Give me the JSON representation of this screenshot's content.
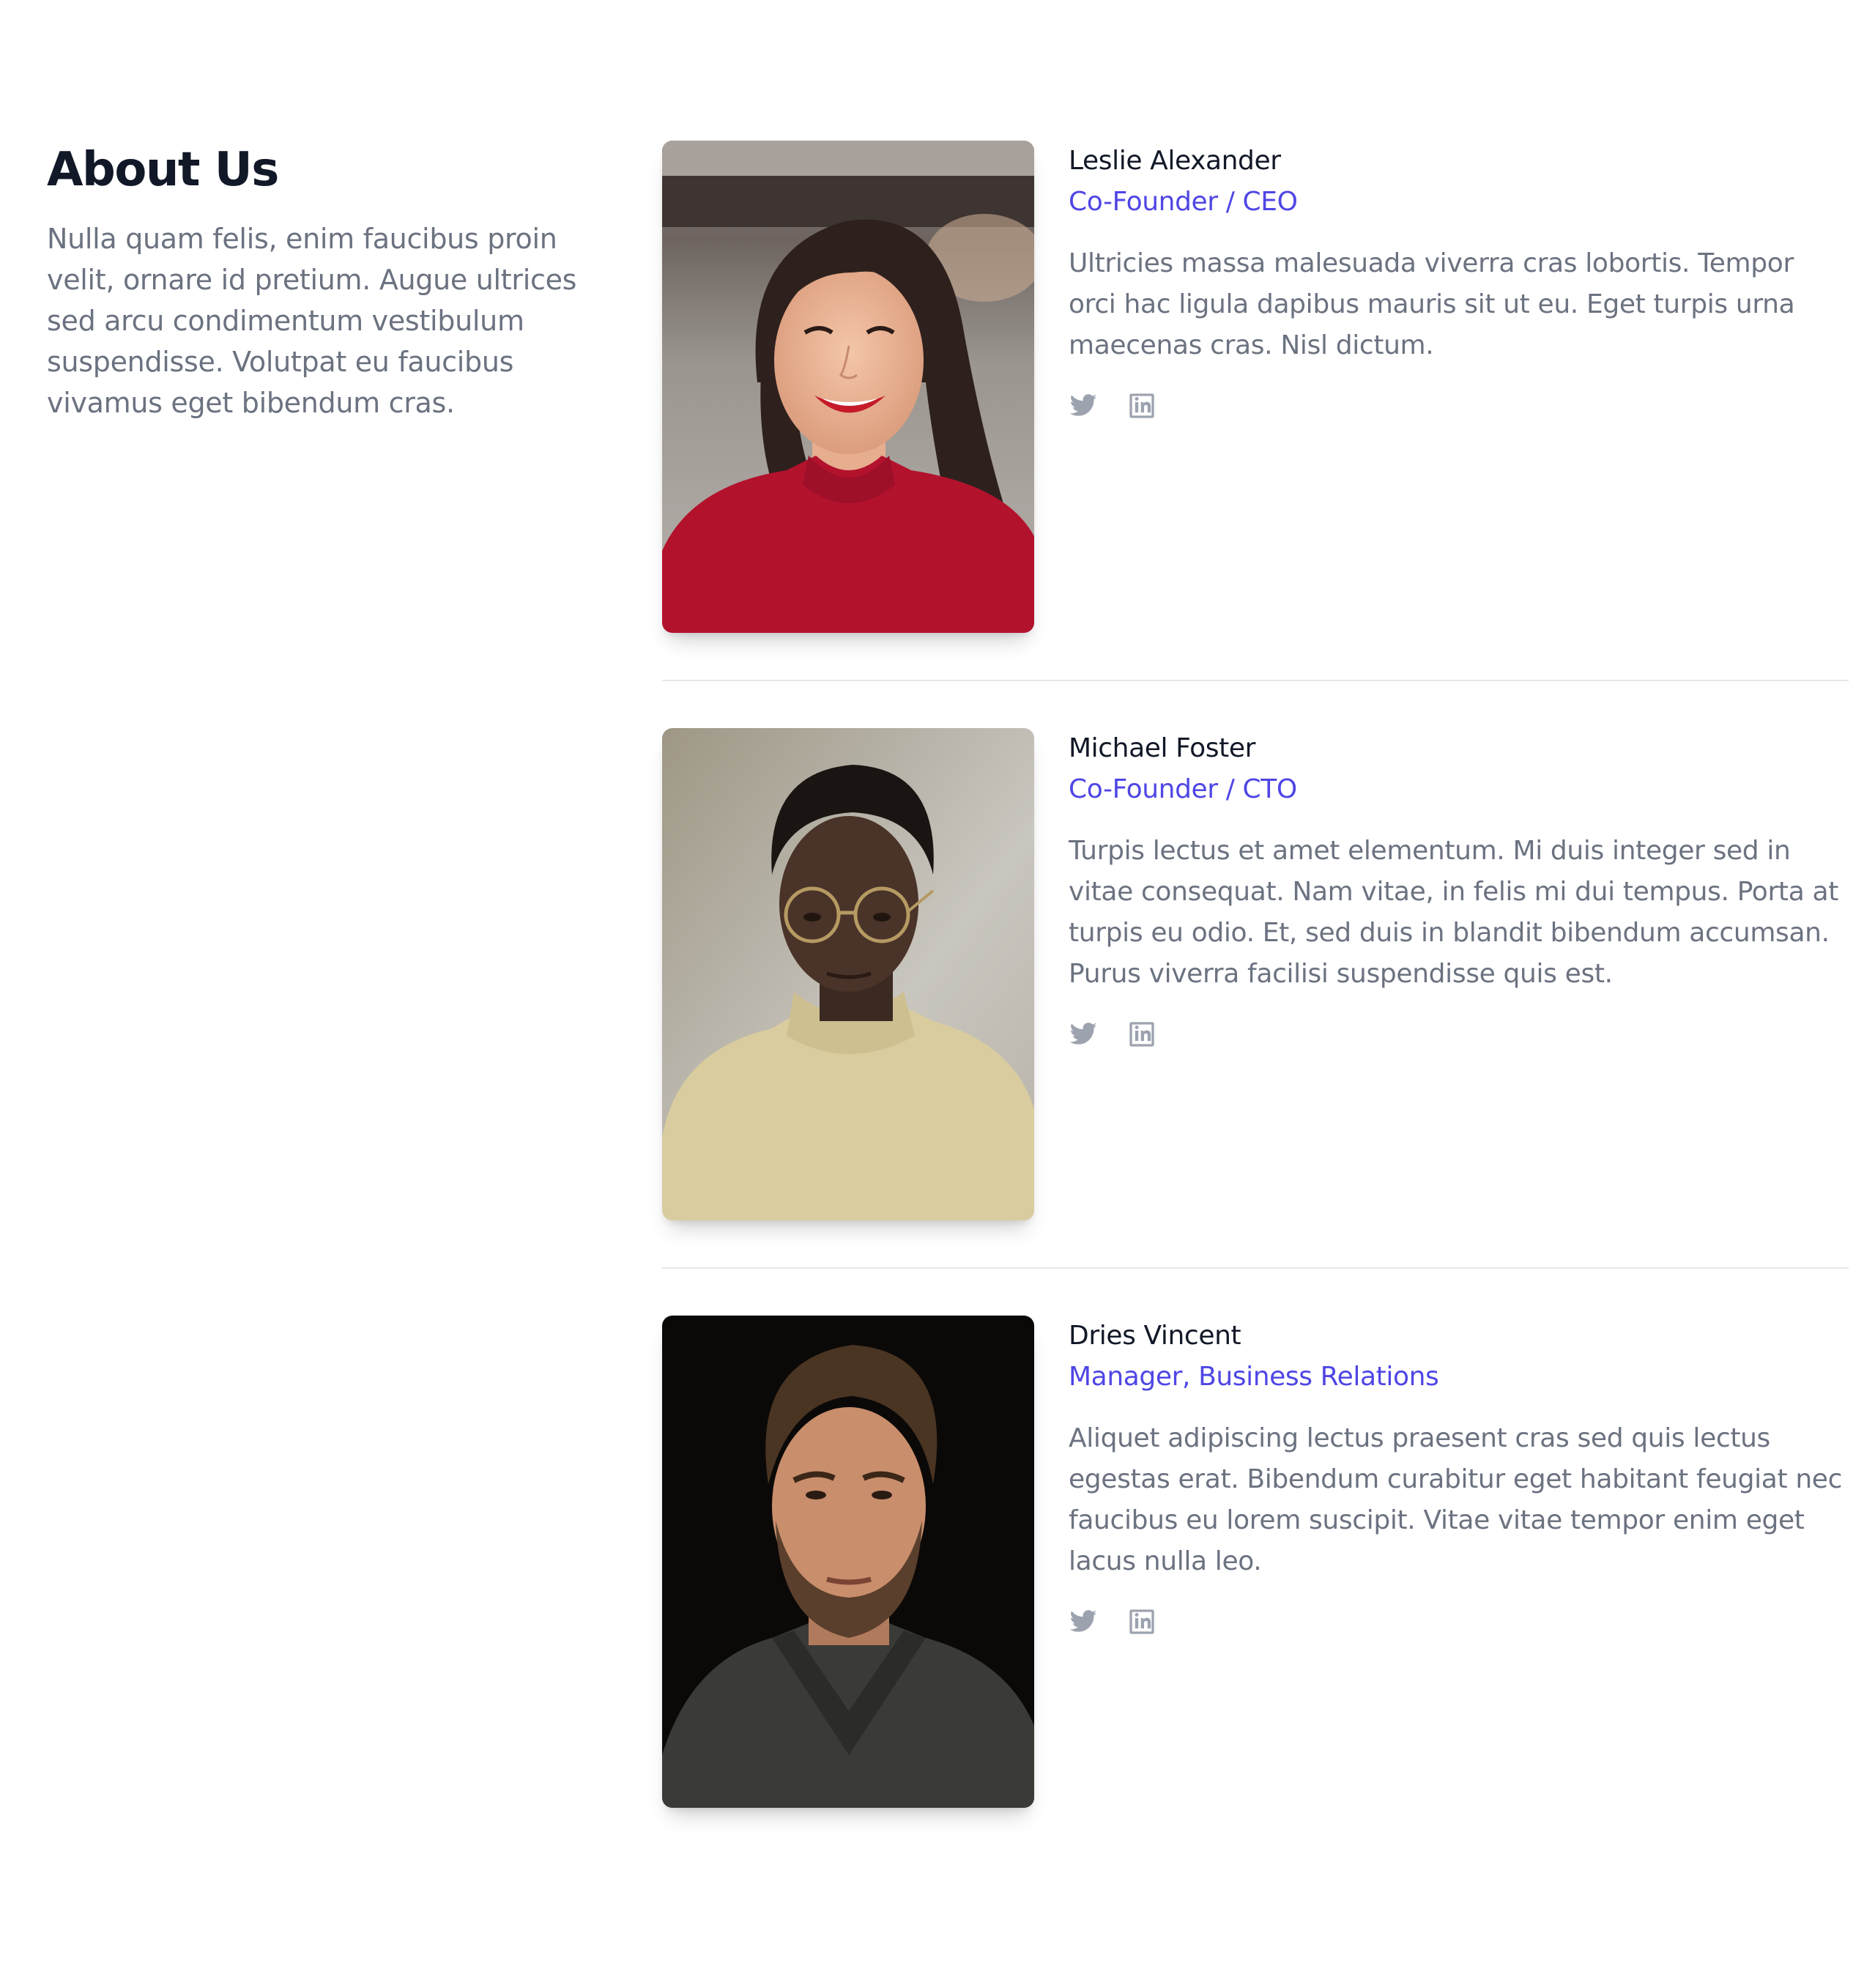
{
  "intro": {
    "title": "About Us",
    "description": "Nulla quam felis, enim faucibus proin velit, ornare id pretium. Augue ultrices sed arcu condimentum vestibulum suspendisse. Volutpat eu faucibus vivamus eget bibendum cras."
  },
  "colors": {
    "heading": "#111827",
    "body": "#6b7280",
    "accent": "#4f46e5",
    "icon": "#9ca3af",
    "divider": "#e5e7eb"
  },
  "team": [
    {
      "name": "Leslie Alexander",
      "role": "Co-Founder / CEO",
      "bio": "Ultricies massa malesuada viverra cras lobortis. Tempor orci hac ligula dapibus mauris sit ut eu. Eget turpis urna maecenas cras. Nisl dictum.",
      "twitter_label": "Twitter",
      "linkedin_label": "LinkedIn",
      "photo_icon": "portrait-woman-red-sweater"
    },
    {
      "name": "Michael Foster",
      "role": "Co-Founder / CTO",
      "bio": "Turpis lectus et amet elementum. Mi duis integer sed in vitae consequat. Nam vitae, in felis mi dui tempus. Porta at turpis eu odio. Et, sed duis in blandit bibendum accumsan. Purus viverra facilisi suspendisse quis est.",
      "twitter_label": "Twitter",
      "linkedin_label": "LinkedIn",
      "photo_icon": "portrait-man-glasses-beige-sweater"
    },
    {
      "name": "Dries Vincent",
      "role": "Manager, Business Relations",
      "bio": "Aliquet adipiscing lectus praesent cras sed quis lectus egestas erat. Bibendum curabitur eget habitant feugiat nec faucibus eu lorem suscipit. Vitae vitae tempor enim eget lacus nulla leo.",
      "twitter_label": "Twitter",
      "linkedin_label": "LinkedIn",
      "photo_icon": "portrait-man-beard-dark-sweater"
    }
  ]
}
